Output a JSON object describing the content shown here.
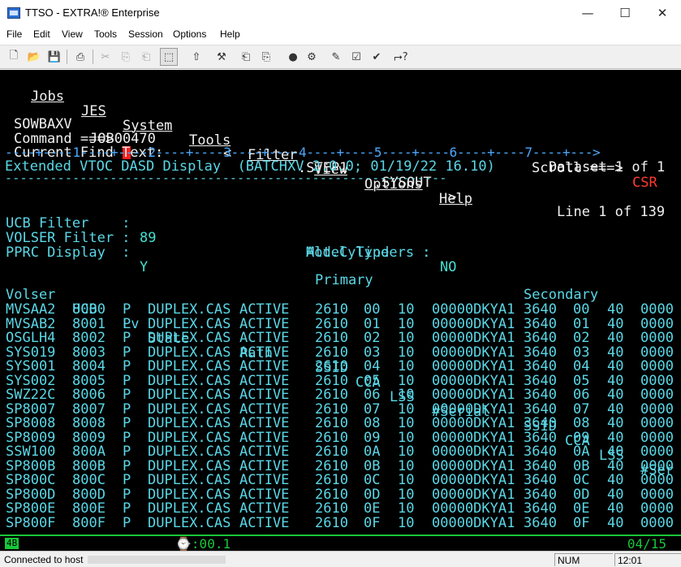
{
  "window": {
    "title": "TTSO - EXTRA!® Enterprise",
    "minimize_icon": "minimize-icon",
    "maximize_icon": "maximize-icon",
    "close_icon": "close-icon"
  },
  "menu": [
    "File",
    "Edit",
    "View",
    "Tools",
    "Session",
    "Options",
    "Help"
  ],
  "terminal": {
    "action_bar": [
      "Jobs",
      "JES",
      "System",
      "Tools",
      "Filter",
      "View",
      "Options",
      "Help"
    ],
    "header": {
      "job_name": "SOWBAXV",
      "job_id": "JOB00470",
      "lt": "<",
      "step": ".STEP1",
      "dd": ".SYSOUT",
      "gt": ">",
      "line_info": "Line 1 of 139",
      "command_label": "Command ===>",
      "scroll_label": "Scroll ===>",
      "scroll_value": "CSR",
      "find_label": "Current Find Text:",
      "dataset_info": "Dataset 1 of 1"
    },
    "ruler": "----+----1----+----2----+----3----+----4----+----5----+----6----+----7----+--->",
    "report_title": "Extended VTOC DASD Display  (BATCHXV 2.0.0; 01/19/22 16.10)",
    "report_underline": "-----------------------------------------------------------",
    "filters": {
      "ucb_filter_label": "UCB Filter    :",
      "ucb_filter_value": "89",
      "volser_filter_label": "VOLSER Filter :",
      "pprc_display_label": "PPRC Display  :",
      "pprc_display_value": "Y",
      "model_type_label": "Model Type    :",
      "alt_cyl_label": "Alt.Cylinders :",
      "alt_cyl_value": "NO"
    },
    "group_headers": {
      "primary": "Primary",
      "secondary": "Secondary"
    },
    "columns": [
      "Volser",
      "UCB",
      "Lv",
      "State",
      "Path",
      "SSID",
      "CCA",
      "LSS",
      "#Serial",
      "SSID",
      "CCA",
      "LSS",
      "#Ser"
    ],
    "rows": [
      [
        "MVSAA2",
        "8000",
        "P",
        "DUPLEX.CAS",
        "ACTIVE",
        "2610",
        "00",
        "10",
        "00000DKYA1",
        "3640",
        "00",
        "40",
        "0000"
      ],
      [
        "MVSAB2",
        "8001",
        "P",
        "DUPLEX.CAS",
        "ACTIVE",
        "2610",
        "01",
        "10",
        "00000DKYA1",
        "3640",
        "01",
        "40",
        "0000"
      ],
      [
        "OSGLH4",
        "8002",
        "P",
        "DUPLEX.CAS",
        "ACTIVE",
        "2610",
        "02",
        "10",
        "00000DKYA1",
        "3640",
        "02",
        "40",
        "0000"
      ],
      [
        "SYS019",
        "8003",
        "P",
        "DUPLEX.CAS",
        "ACTIVE",
        "2610",
        "03",
        "10",
        "00000DKYA1",
        "3640",
        "03",
        "40",
        "0000"
      ],
      [
        "SYS001",
        "8004",
        "P",
        "DUPLEX.CAS",
        "ACTIVE",
        "2610",
        "04",
        "10",
        "00000DKYA1",
        "3640",
        "04",
        "40",
        "0000"
      ],
      [
        "SYS002",
        "8005",
        "P",
        "DUPLEX.CAS",
        "ACTIVE",
        "2610",
        "05",
        "10",
        "00000DKYA1",
        "3640",
        "05",
        "40",
        "0000"
      ],
      [
        "SWZ22C",
        "8006",
        "P",
        "DUPLEX.CAS",
        "ACTIVE",
        "2610",
        "06",
        "10",
        "00000DKYA1",
        "3640",
        "06",
        "40",
        "0000"
      ],
      [
        "SP8007",
        "8007",
        "P",
        "DUPLEX.CAS",
        "ACTIVE",
        "2610",
        "07",
        "10",
        "00000DKYA1",
        "3640",
        "07",
        "40",
        "0000"
      ],
      [
        "SP8008",
        "8008",
        "P",
        "DUPLEX.CAS",
        "ACTIVE",
        "2610",
        "08",
        "10",
        "00000DKYA1",
        "3640",
        "08",
        "40",
        "0000"
      ],
      [
        "SP8009",
        "8009",
        "P",
        "DUPLEX.CAS",
        "ACTIVE",
        "2610",
        "09",
        "10",
        "00000DKYA1",
        "3640",
        "09",
        "40",
        "0000"
      ],
      [
        "SSW100",
        "800A",
        "P",
        "DUPLEX.CAS",
        "ACTIVE",
        "2610",
        "0A",
        "10",
        "00000DKYA1",
        "3640",
        "0A",
        "40",
        "0000"
      ],
      [
        "SP800B",
        "800B",
        "P",
        "DUPLEX.CAS",
        "ACTIVE",
        "2610",
        "0B",
        "10",
        "00000DKYA1",
        "3640",
        "0B",
        "40",
        "0000"
      ],
      [
        "SP800C",
        "800C",
        "P",
        "DUPLEX.CAS",
        "ACTIVE",
        "2610",
        "0C",
        "10",
        "00000DKYA1",
        "3640",
        "0C",
        "40",
        "0000"
      ],
      [
        "SP800D",
        "800D",
        "P",
        "DUPLEX.CAS",
        "ACTIVE",
        "2610",
        "0D",
        "10",
        "00000DKYA1",
        "3640",
        "0D",
        "40",
        "0000"
      ],
      [
        "SP800E",
        "800E",
        "P",
        "DUPLEX.CAS",
        "ACTIVE",
        "2610",
        "0E",
        "10",
        "00000DKYA1",
        "3640",
        "0E",
        "40",
        "0000"
      ],
      [
        "SP800F",
        "800F",
        "P",
        "DUPLEX.CAS",
        "ACTIVE",
        "2610",
        "0F",
        "10",
        "00000DKYA1",
        "3640",
        "0F",
        "40",
        "0000"
      ]
    ]
  },
  "oia": {
    "indicator": "4B",
    "clock": ":00.1",
    "position": "04/15"
  },
  "statusbar": {
    "connection": "Connected to host",
    "num": "NUM",
    "time": "12:01"
  },
  "colors": {
    "terminal_bg": "#000000",
    "terminal_text": "#5ad7e6",
    "terminal_white": "#f0f0f0",
    "terminal_red": "#ff3b30",
    "oia_green": "#18c73a"
  }
}
